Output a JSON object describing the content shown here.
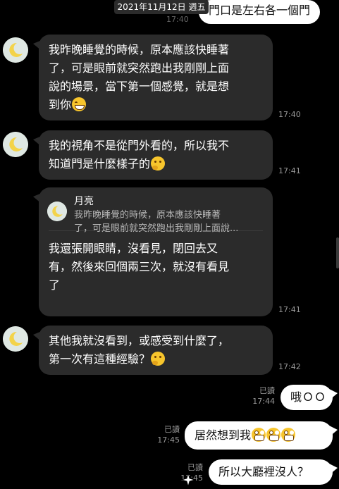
{
  "chat": {
    "date_label": "2021年11月12日 週五",
    "first_msg_time": "17:40",
    "read_label": "已讀",
    "messages": [
      {
        "dir": "out",
        "text": "門口是左右各一個門"
      },
      {
        "dir": "in",
        "lines": [
          "我昨晚睡覺的時候，原本應該快睡著",
          "了，可是眼前就突然跑出我剛剛上面",
          "說的場景，當下第一個感覺，就是想",
          "到你"
        ],
        "emoji": "grinning-squinting-face-icon",
        "time": "17:40"
      },
      {
        "dir": "in",
        "lines": [
          "我的視角不是從門外看的，所以我不",
          "知道門是什麼樣子的"
        ],
        "emoji": "thinking-face-icon",
        "time": "17:41"
      },
      {
        "dir": "in",
        "reply": {
          "name": "月亮",
          "snippet": [
            "我昨晚睡覺的時候，原本應該快睡著",
            "了，可是眼前就突然跑出我剛剛上面說..."
          ]
        },
        "lines": [
          "我還張開眼睛，沒看見，閉回去又",
          "有，然後來回個兩三次，就沒有看見",
          "了"
        ],
        "time": "17:41"
      },
      {
        "dir": "in",
        "lines": [
          "其他我就沒看到，或感受到什麼了，",
          "第一次有這種經驗？"
        ],
        "emoji": "thinking-face-icon",
        "time": "17:42"
      },
      {
        "dir": "out",
        "text": "哦ＯＯ",
        "read": "已讀",
        "time": "17:44"
      },
      {
        "dir": "out",
        "text": "居然想到我",
        "emoji": "screaming-face-icon",
        "read": "已讀",
        "time": "17:45"
      },
      {
        "dir": "out",
        "text": "所以大廳裡沒人？",
        "read": "已讀",
        "time": "17:45"
      }
    ]
  },
  "colors": {
    "background": "#000000",
    "incoming_bubble": "#2b2b2b",
    "outgoing_bubble": "#ffffff",
    "meta_text": "#9a9a9a"
  }
}
